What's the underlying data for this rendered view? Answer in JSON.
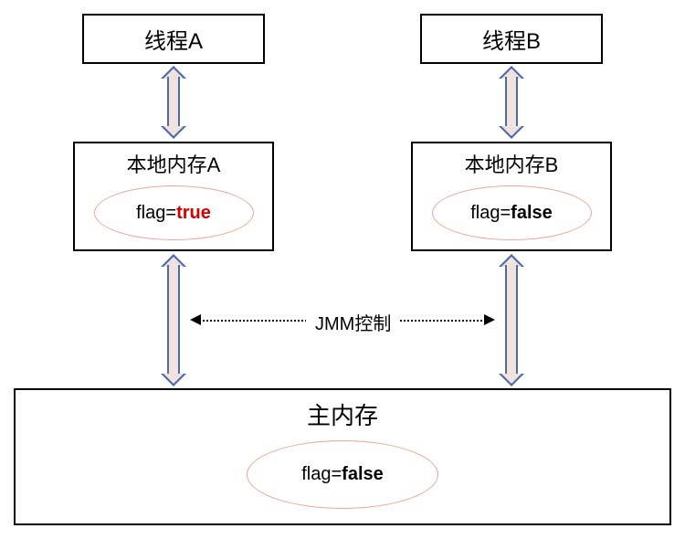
{
  "threadA": {
    "label": "线程A"
  },
  "threadB": {
    "label": "线程B"
  },
  "localA": {
    "title": "本地内存A",
    "flag_prefix": "flag=",
    "flag_value": "true"
  },
  "localB": {
    "title": "本地内存B",
    "flag_prefix": "flag=",
    "flag_value": "false"
  },
  "jmm": {
    "label": "JMM控制"
  },
  "mainMem": {
    "title": "主内存",
    "flag_prefix": "flag=",
    "flag_value": "false"
  }
}
